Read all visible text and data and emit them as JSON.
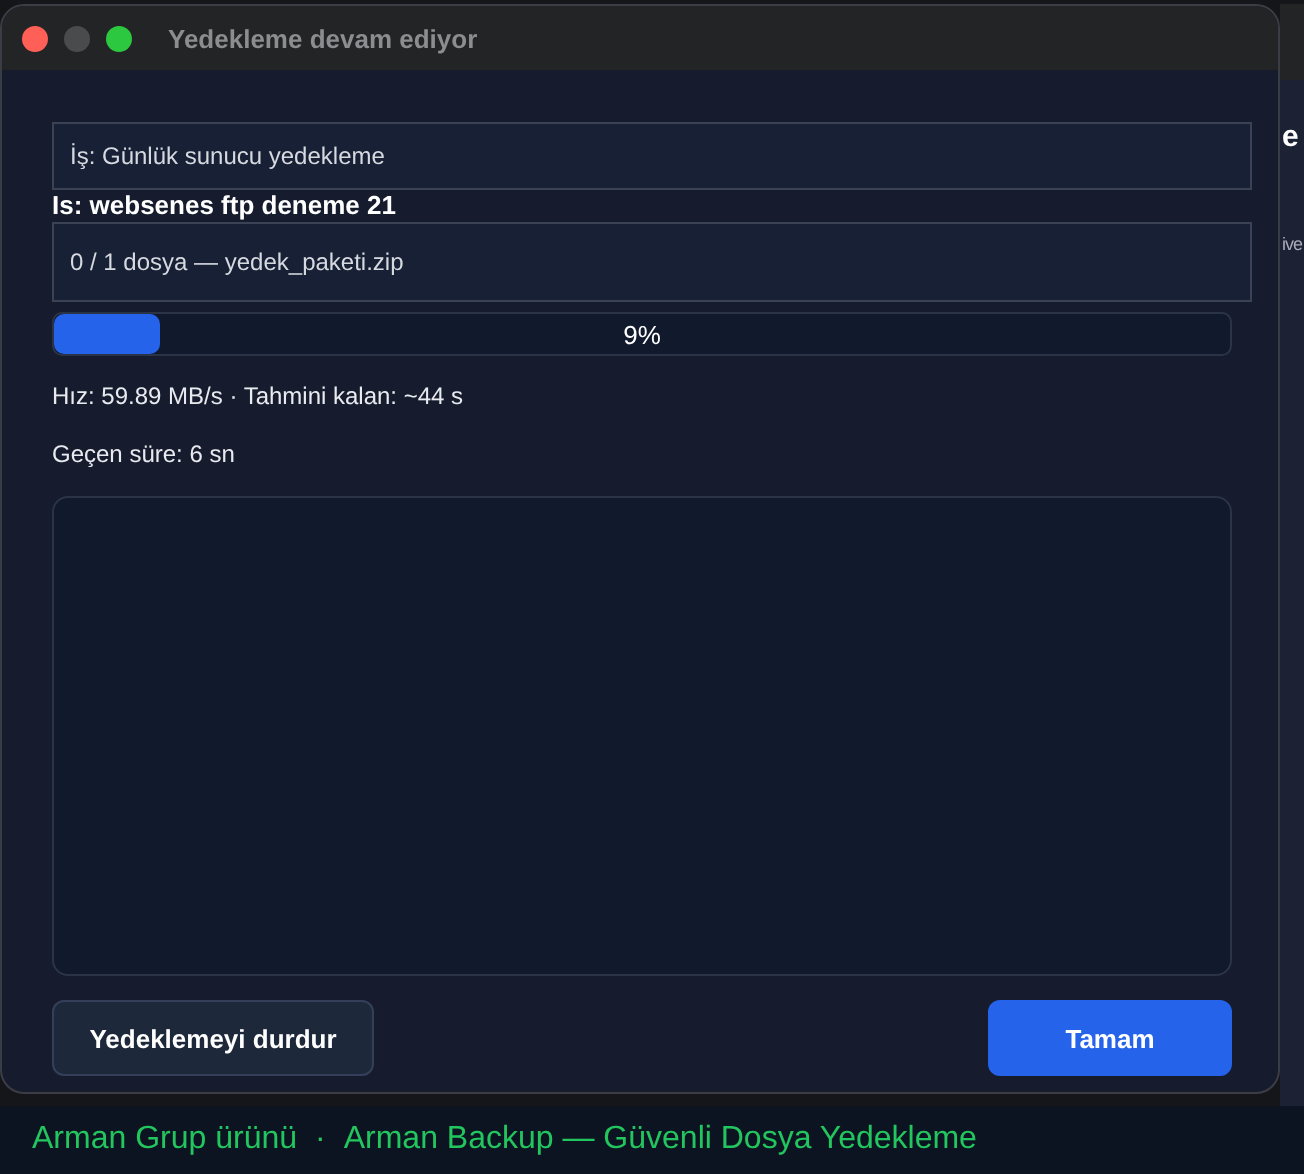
{
  "window": {
    "title": "Yedekleme devam ediyor"
  },
  "job_line": "Is: websenes ftp deneme 21",
  "overlay_boxes": [
    "İş: Günlük sunucu yedekleme",
    "0 / 1 dosya — yedek_paketi.zip"
  ],
  "progress": {
    "level": 0.09,
    "label": "9%"
  },
  "stats": [
    "Hız: 59.89 MB/s · Tahmini kalan: ~44 s",
    "Geçen süre: 6 sn"
  ],
  "buttons": [
    {
      "label": "Yedeklemeyi durdur",
      "kind": "secondary"
    },
    {
      "label": "Tamam",
      "kind": "primary"
    }
  ],
  "background_window": {
    "fragments": [
      "e",
      "ive"
    ]
  },
  "footer": {
    "left": "Arman Grup ürünü",
    "separator": "·",
    "right": "Arman Backup — Güvenli Dosya Yedekleme"
  }
}
